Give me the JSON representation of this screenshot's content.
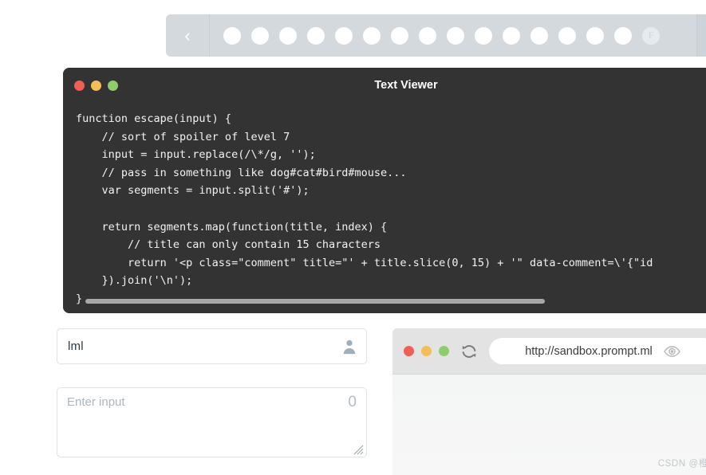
{
  "topbar": {
    "prev_icon": "chevron-left-icon",
    "next_icon": "chevron-right-icon",
    "prev_label": "‹",
    "next_label": "›",
    "dots": [
      "",
      "",
      "",
      "",
      "",
      "",
      "",
      "",
      "",
      "",
      "",
      "",
      "",
      "",
      "",
      "F"
    ],
    "background_color": "#d3d9dd"
  },
  "viewer": {
    "title": "Text Viewer",
    "lights": [
      "close",
      "minimize",
      "maximize"
    ],
    "light_colors": {
      "close": "#ef5f56",
      "minimize": "#f4bd57",
      "maximize": "#8fcd6a"
    },
    "background_color": "#333333",
    "code": "function escape(input) {\n    // sort of spoiler of level 7\n    input = input.replace(/\\*/g, '');\n    // pass in something like dog#cat#bird#mouse...\n    var segments = input.split('#');\n\n    return segments.map(function(title, index) {\n        // title can only contain 15 characters\n        return '<p class=\"comment\" title=\"' + title.slice(0, 15) + '\" data-comment=\\'{\"id\n    }).join('\\n');\n}",
    "scrollbar": "horizontal"
  },
  "form": {
    "text_input": {
      "value": "lml",
      "placeholder": "",
      "icon": "person-icon"
    },
    "textarea": {
      "value": "",
      "placeholder": "Enter input",
      "counter": "0",
      "resize_handle": "resize-grip-icon"
    }
  },
  "browser": {
    "lights": [
      "close",
      "minimize",
      "maximize"
    ],
    "refresh_icon": "refresh-icon",
    "url": "http://sandbox.prompt.ml",
    "eye_icon": "eye-icon",
    "background_color": "#e3e3e3"
  },
  "watermark": "CSDN @橙栎"
}
